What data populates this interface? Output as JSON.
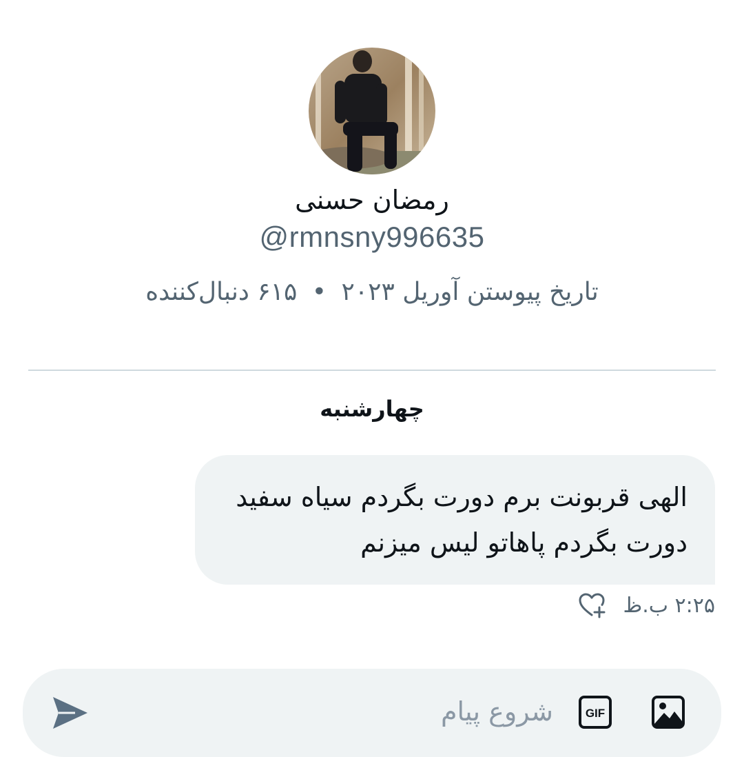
{
  "profile": {
    "display_name": "رمضان حسنی",
    "handle": "@rmnsny996635",
    "joined": "تاریخ پیوستن آوریل ۲۰۲۳",
    "separator": "•",
    "followers": "۶۱۵ دنبال‌کننده"
  },
  "conversation": {
    "day_label": "چهارشنبه",
    "message": {
      "line1": "الهی قربونت برم دورت بگردم سیاه سفید",
      "line2": "دورت بگردم پاهاتو لیس میزنم",
      "time": "۲:۲۵ ب.ظ"
    }
  },
  "composer": {
    "placeholder": "شروع پیام",
    "gif_label": "GIF"
  },
  "icons": {
    "react": "heart-plus-icon",
    "image": "image-icon",
    "gif": "gif-icon",
    "send": "send-icon"
  },
  "colors": {
    "text_primary": "#0f1419",
    "text_secondary": "#536471",
    "bubble_bg": "#eff3f4",
    "divider": "#cfd9de"
  }
}
